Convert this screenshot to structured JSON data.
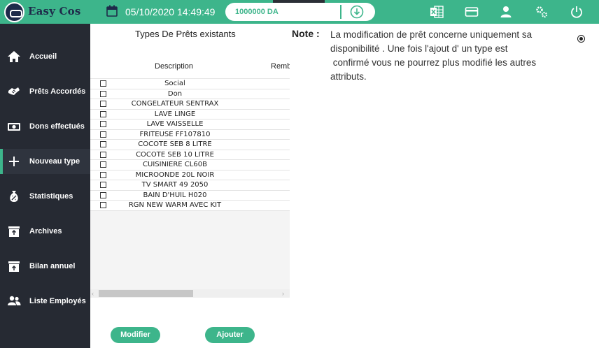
{
  "app": {
    "name": "Easy Cos",
    "datetime": "05/10/2020 14:49:49",
    "balance": "1000000 DA"
  },
  "colors": {
    "accent": "#3db58b",
    "sidebar": "#262a33",
    "logo_dark": "#1e2a4a"
  },
  "topbar_icons": [
    "excel-icon",
    "card-icon",
    "user-icon",
    "settings-icon",
    "power-icon"
  ],
  "sidebar": {
    "items": [
      {
        "label": "Accueil",
        "icon": "home-icon",
        "active": false
      },
      {
        "label": "Prêts Accordés",
        "icon": "handshake-icon",
        "active": false
      },
      {
        "label": "Dons effectués",
        "icon": "money-icon",
        "active": false
      },
      {
        "label": "Nouveau type",
        "icon": "plus-icon",
        "active": true
      },
      {
        "label": "Statistiques",
        "icon": "moneybag-icon",
        "active": false
      },
      {
        "label": "Archives",
        "icon": "archive-icon",
        "active": false
      },
      {
        "label": "Bilan annuel",
        "icon": "upload-box-icon",
        "active": false
      },
      {
        "label": "Liste Employés",
        "icon": "people-icon",
        "active": false
      }
    ]
  },
  "list": {
    "title": "Types De Prêts existants",
    "columns": [
      "Description",
      "Remb"
    ],
    "rows": [
      "Social",
      "Don",
      "CONGELATEUR SENTRAX",
      "LAVE LINGE",
      "LAVE VAISSELLE",
      "FRITEUSE FF107810",
      "COCOTE SEB 8 LITRE",
      "COCOTE SEB 10 LITRE",
      "CUISINIERE CL60B",
      "MICROONDE 20L NOIR",
      "TV SMART 49 2050",
      "BAIN D'HUIL H020",
      "RGN NEW WARM AVEC KIT"
    ]
  },
  "note": {
    "label": "Note :",
    "lines": [
      "La modification de prêt concerne uniquement sa",
      "disponibilité . Une fois l'ajout d' un type est",
      " confirmé vous ne pourrez plus modifié les autres",
      "attributs."
    ]
  },
  "buttons": {
    "modify": "Modifier",
    "add": "Ajouter"
  }
}
